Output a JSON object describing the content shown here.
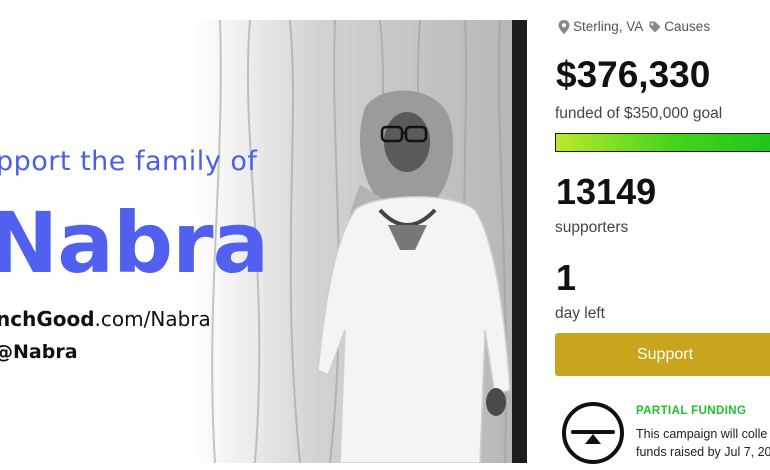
{
  "hero": {
    "headline": "pport the family of",
    "name": "Nabra",
    "url_brand": "nchGood",
    "url_path": ".com/Nabra",
    "handle": "@Nabra"
  },
  "meta": {
    "location": "Sterling, VA",
    "category": "Causes",
    "location_icon": "map-pin-icon",
    "category_icon": "tag-icon"
  },
  "funding": {
    "amount": "$376,330",
    "goal_text": "funded of $350,000 goal",
    "progress_fraction": 1.0
  },
  "supporters": {
    "count": "13149",
    "label": "supporters"
  },
  "time_left": {
    "value": "1",
    "label": "day left"
  },
  "actions": {
    "support_label": "Support"
  },
  "partial_funding": {
    "title": "PARTIAL FUNDING",
    "line1": "This campaign will colle",
    "line2": "funds raised by Jul 7, 20",
    "icon": "scale-balance-icon"
  },
  "colors": {
    "brand_blue": "#5160ee",
    "support_button": "#c9a41d",
    "progress_start": "#b9ea2c",
    "progress_end": "#1fc51a",
    "partial_green": "#1fbf2e"
  }
}
